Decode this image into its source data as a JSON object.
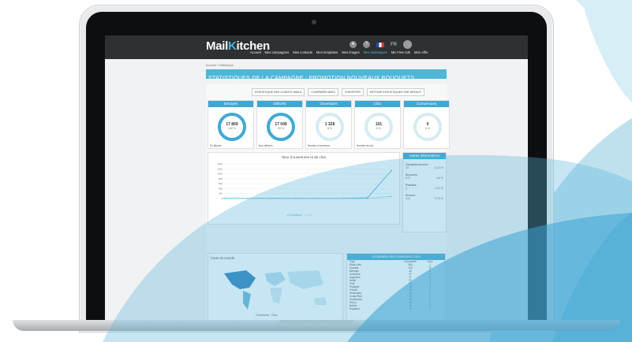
{
  "app": {
    "logo_a": "Mail",
    "logo_b": "K",
    "logo_c": "itchen",
    "lang": "FR",
    "nav": [
      "Accueil",
      "Mes campagnes",
      "Mes contacts",
      "Mes templates",
      "Mes images",
      "Mes statistiques",
      "MK Free Ads",
      "Mon offre"
    ],
    "breadcrumb": "Accueil  /  Statistique",
    "page_title": "STATISTIQUES DE LA CAMPAGNE : PROMOTION NOUVEAUX BOUQUETS"
  },
  "actions": [
    "STATISTIQUE DES CLIENTS MAILS",
    "COMPARER AVEC",
    "EXPORTER",
    "RETOUR STATISTIQUES PAR DÉFAUT"
  ],
  "stats": [
    {
      "title": "Envoyés",
      "value": "17 869",
      "pct": "100 %",
      "sub": "En attente"
    },
    {
      "title": "Délivrés",
      "value": "17 049",
      "pct": "99 %",
      "sub": "Non délivrés"
    },
    {
      "title": "Ouvertures",
      "value": "1 328",
      "pct": "8 %",
      "sub": "Nombre d'ouverture"
    },
    {
      "title": "Clics",
      "value": "101",
      "pct": "8 %",
      "sub": "Nombre de clic"
    },
    {
      "title": "Conversions",
      "value": "0",
      "pct": "0 %",
      "sub": ""
    }
  ],
  "chart_data": {
    "type": "line",
    "title": "Taux d'ouvertures et de clics",
    "y_ticks": [
      "1400",
      "1200",
      "1000",
      "800",
      "600",
      "400",
      "200",
      "0"
    ],
    "ylim": [
      0,
      1400
    ],
    "series": [
      {
        "name": "Ouvertures",
        "values": [
          10,
          12,
          14,
          15,
          16,
          17,
          30,
          1130
        ]
      },
      {
        "name": "Clics",
        "values": [
          0,
          0,
          1,
          1,
          2,
          2,
          5,
          90
        ]
      }
    ],
    "legend": "bottom-center"
  },
  "info": {
    "title": "Autres informations",
    "rows": [
      {
        "label": "Désabonnement",
        "count": "24",
        "pct": "0,13 %"
      },
      {
        "label": "Bounces",
        "count": "670",
        "pct": "3,8 %"
      },
      {
        "label": "Plaintes",
        "count": "3",
        "pct": "0,02 %"
      },
      {
        "label": "Erreurs",
        "count": "141",
        "pct": "0,79 %"
      }
    ]
  },
  "map": {
    "title": "Carte du monde",
    "legend_a": "Ouvertures",
    "legend_b": "Clics"
  },
  "locations": {
    "title": "Localisation des ouvertures / clics",
    "headers": [
      "Pays",
      "Ouvertures",
      "Clics"
    ],
    "rows": [
      [
        "États-Unis",
        "384",
        "2"
      ],
      [
        "Canada",
        "120",
        "12"
      ],
      [
        "Mexique",
        "44",
        "3"
      ],
      [
        "Colombie",
        "37",
        "2"
      ],
      [
        "Argentine",
        "27",
        "2"
      ],
      [
        "Brésil",
        "22",
        "1"
      ],
      [
        "Chili",
        "20",
        "0"
      ],
      [
        "Espagne",
        "18",
        "3"
      ],
      [
        "France",
        "18",
        "2"
      ],
      [
        "Venezuela",
        "13",
        "1"
      ],
      [
        "Costa Rica",
        "12",
        "0"
      ],
      [
        "Guatemala",
        "10",
        "1"
      ],
      [
        "Pérou",
        "10",
        "2"
      ],
      [
        "Bolivie",
        "8",
        "1"
      ],
      [
        "Équateur",
        "5",
        "1"
      ]
    ]
  },
  "colors": {
    "accent": "#3fa8d2",
    "dark": "#2f3032"
  }
}
